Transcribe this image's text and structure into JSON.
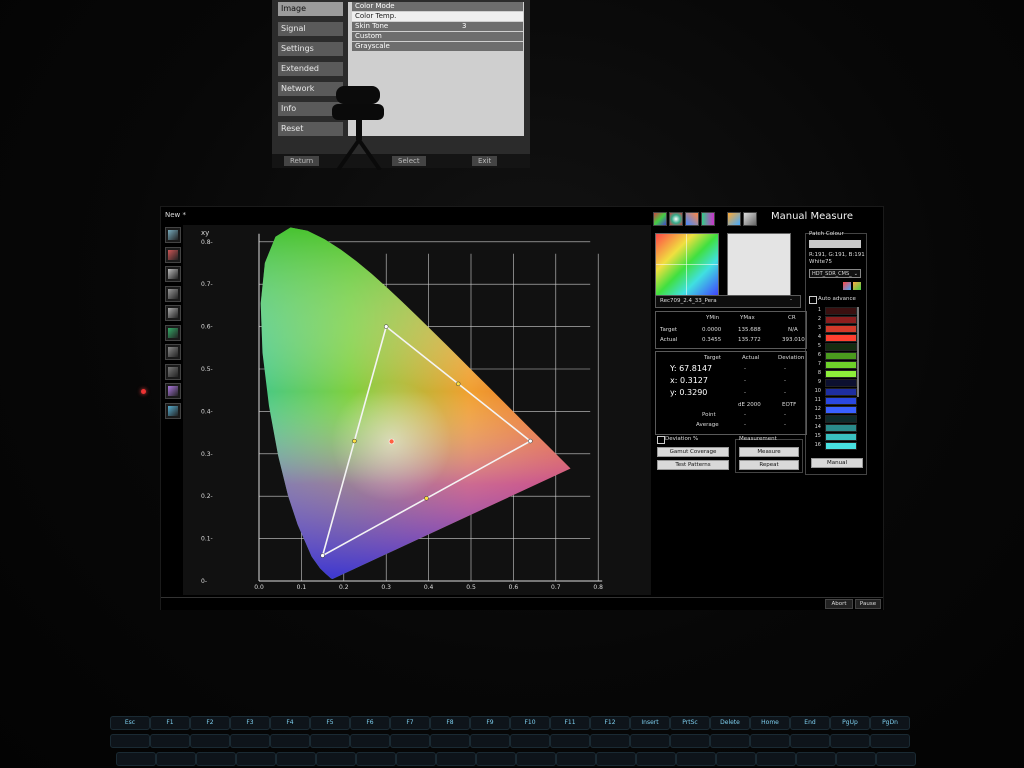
{
  "projection": {
    "menu_items": [
      "Image",
      "Signal",
      "Settings",
      "Extended",
      "Network",
      "Info",
      "Reset"
    ],
    "active_index": 0,
    "sub_rows": [
      "Color Mode",
      "Color Temp.",
      "Skin Tone",
      "Custom",
      "Grayscale"
    ],
    "sub_values": [
      "",
      "",
      "3",
      "",
      ""
    ],
    "buttons": [
      "Return",
      "Select",
      "Exit"
    ]
  },
  "window": {
    "tab_label": "New *",
    "controls": [
      "–",
      "❐",
      "✕"
    ]
  },
  "toolbar_left": {
    "icons": [
      "cie-diagram-icon",
      "rgb-icon",
      "luminance-icon",
      "gamma-icon",
      "greyscale-icon",
      "rgb-balance-icon",
      "contrast-icon",
      "delta-e-icon",
      "saturation-icon",
      "colorchecker-icon"
    ],
    "colors": [
      "#7ab",
      "#c55",
      "#bbb",
      "#999",
      "#aaa",
      "#3a6",
      "#888",
      "#777",
      "#a7d",
      "#5ac"
    ]
  },
  "chart_data": {
    "type": "scatter",
    "title": "xy",
    "xlabel": "",
    "ylabel": "",
    "xlim": [
      0.0,
      0.8
    ],
    "ylim": [
      0.0,
      0.8
    ],
    "xticks": [
      "0.0",
      "0.1",
      "0.2",
      "0.3",
      "0.4",
      "0.5",
      "0.6",
      "0.7",
      "0.8"
    ],
    "yticks": [
      "0-",
      "0.1-",
      "0.2-",
      "0.3-",
      "0.4-",
      "0.5-",
      "0.6-",
      "0.7-",
      "0.8-"
    ],
    "grid": true,
    "target_gamut": [
      [
        0.64,
        0.33
      ],
      [
        0.3,
        0.6
      ],
      [
        0.15,
        0.06
      ]
    ],
    "measured_point": [
      0.3127,
      0.329
    ]
  },
  "panel": {
    "title": "Manual Measure",
    "patch_colour_label": "Patch Colour",
    "patch_values": "R:191, G:191, B:191",
    "patch_name": "White75",
    "patch_set": "HDT_SDR_CMS_",
    "auto_advance": "Auto advance",
    "profile_name": "Rec709_2.4_33_Pera",
    "table1": {
      "headers": [
        "YMin",
        "YMax",
        "CR"
      ],
      "rows": [
        {
          "label": "Target",
          "values": [
            "0.0000",
            "135.688",
            "N/A"
          ]
        },
        {
          "label": "Actual",
          "values": [
            "0.3455",
            "135.772",
            "393.010"
          ]
        }
      ]
    },
    "table2": {
      "headers": [
        "Target",
        "Actual",
        "Deviation"
      ],
      "Y": "Y:  67.8147",
      "x": "x:  0.3127",
      "y": "y:  0.3290",
      "de_label": "dE 2000",
      "eotf_label": "EOTF",
      "point_label": "Point",
      "average_label": "Average",
      "dash": "-"
    },
    "deviation_label": "Deviation %",
    "measurement_label": "Measurement",
    "buttons": {
      "gamut": "Gamut Coverage",
      "test_patterns": "Test Patterns",
      "measure": "Measure",
      "repeat": "Repeat",
      "manual": "Manual"
    },
    "swatches": [
      {
        "n": "1",
        "color": "#3a1010"
      },
      {
        "n": "2",
        "color": "#8a1e1e"
      },
      {
        "n": "3",
        "color": "#d23a2a"
      },
      {
        "n": "4",
        "color": "#ff4030"
      },
      {
        "n": "5",
        "color": "#142c10"
      },
      {
        "n": "6",
        "color": "#4a9a1e"
      },
      {
        "n": "7",
        "color": "#6ed02a"
      },
      {
        "n": "8",
        "color": "#8ef03a"
      },
      {
        "n": "9",
        "color": "#0c1030"
      },
      {
        "n": "10",
        "color": "#1e2ea0"
      },
      {
        "n": "11",
        "color": "#2a48e0"
      },
      {
        "n": "12",
        "color": "#3a60ff"
      },
      {
        "n": "13",
        "color": "#0e2a2a"
      },
      {
        "n": "14",
        "color": "#2a8a8a"
      },
      {
        "n": "15",
        "color": "#3ac0c0"
      },
      {
        "n": "16",
        "color": "#48e0e0"
      }
    ]
  },
  "bottom": {
    "abort": "Abort",
    "pause": "Pause"
  },
  "keyboard": {
    "row1": [
      "Esc",
      "F1",
      "F2",
      "F3",
      "F4",
      "F5",
      "F6",
      "F7",
      "F8",
      "F9",
      "F10",
      "F11",
      "F12",
      "Insert",
      "PrtSc",
      "Delete",
      "Home",
      "End",
      "PgUp",
      "PgDn"
    ]
  }
}
